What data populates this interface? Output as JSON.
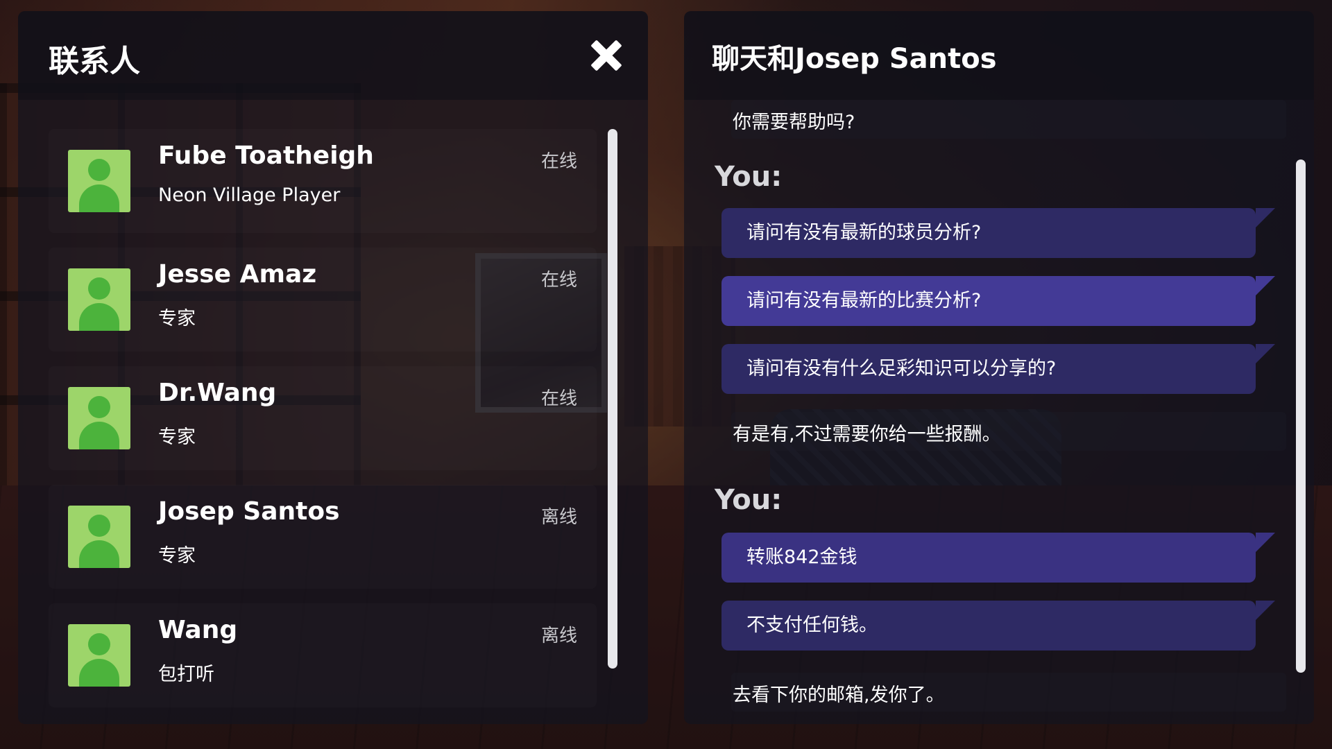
{
  "contacts_panel": {
    "title": "联系人",
    "contacts": [
      {
        "name": "Fube Toatheigh",
        "role": "Neon Village Player",
        "status": "在线"
      },
      {
        "name": "Jesse Amaz",
        "role": "专家",
        "status": "在线"
      },
      {
        "name": "Dr.Wang",
        "role": "专家",
        "status": "在线"
      },
      {
        "name": "Josep Santos",
        "role": "专家",
        "status": "离线"
      },
      {
        "name": "Wang",
        "role": "包打听",
        "status": "离线"
      }
    ]
  },
  "chat_panel": {
    "title": "聊天和Josep Santos",
    "messages": {
      "incoming_1": "你需要帮助吗?",
      "you_label_1": "You:",
      "option_1": "请问有没有最新的球员分析?",
      "option_2": "请问有没有最新的比赛分析?",
      "option_3": "请问有没有什么足彩知识可以分享的?",
      "incoming_2": "有是有,不过需要你给一些报酬。",
      "you_label_2": "You:",
      "option_4": "转账842金钱",
      "option_5": "不支付任何钱。",
      "incoming_3": "去看下你的邮箱,发你了。"
    }
  },
  "colors": {
    "avatar_bg": "#9dd56a",
    "avatar_fg": "#4cb33c",
    "option_bg": "#2e2a64",
    "option_selected_bg": "#433a96"
  }
}
